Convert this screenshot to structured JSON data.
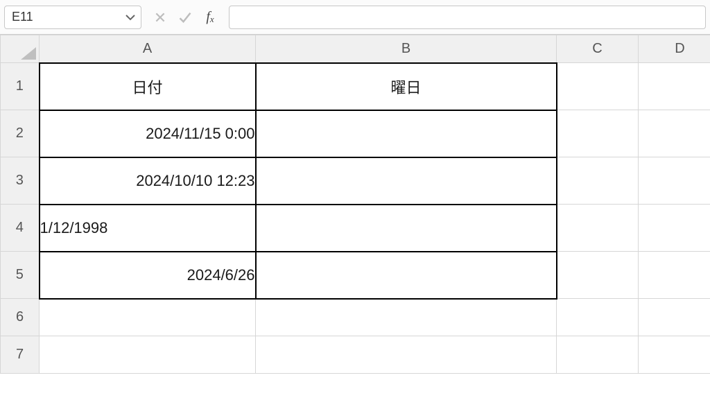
{
  "formula_bar": {
    "name_box": "E11",
    "formula": ""
  },
  "columns": {
    "A": "A",
    "B": "B",
    "C": "C",
    "D": "D"
  },
  "rows": {
    "1": "1",
    "2": "2",
    "3": "3",
    "4": "4",
    "5": "5",
    "6": "6",
    "7": "7"
  },
  "cells": {
    "A1": "日付",
    "B1": "曜日",
    "A2": "2024/11/15 0:00",
    "A3": "2024/10/10 12:23",
    "A4": "1/12/1998",
    "A5": "2024/6/26"
  }
}
